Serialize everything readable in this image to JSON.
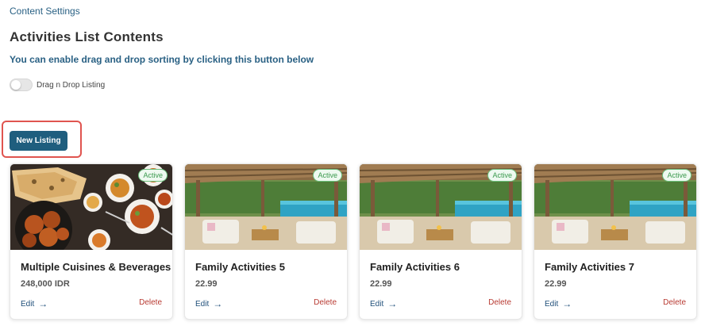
{
  "header": {
    "breadcrumb": "Content Settings",
    "title": "Activities List Contents",
    "hint": "You can enable drag and drop sorting by clicking this button below"
  },
  "drag_toggle": {
    "label": "Drag n Drop Listing",
    "enabled": false
  },
  "new_listing_button": {
    "label": "New Listing"
  },
  "cards": [
    {
      "title": "Multiple Cuisines & Beverages",
      "price": "248,000 IDR",
      "status": "Active",
      "edit_label": "Edit",
      "delete_label": "Delete",
      "image": "food-platter"
    },
    {
      "title": "Family Activities 5",
      "price": "22.99",
      "status": "Active",
      "edit_label": "Edit",
      "delete_label": "Delete",
      "image": "pool-pavilion"
    },
    {
      "title": "Family Activities 6",
      "price": "22.99",
      "status": "Active",
      "edit_label": "Edit",
      "delete_label": "Delete",
      "image": "pool-pavilion"
    },
    {
      "title": "Family Activities 7",
      "price": "22.99",
      "status": "Active",
      "edit_label": "Edit",
      "delete_label": "Delete",
      "image": "pool-pavilion"
    }
  ],
  "colors": {
    "primary_button": "#1f5e7e",
    "heading_blue": "#2a6184",
    "active_badge": "#3b9a4e",
    "delete_red": "#b83a32",
    "highlight_red": "#e0544f"
  }
}
